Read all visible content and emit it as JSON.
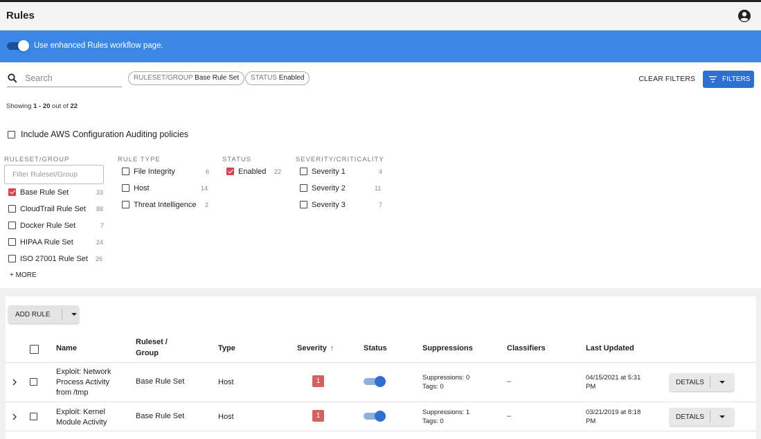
{
  "header": {
    "title": "Rules",
    "account_icon": "account-circle-icon"
  },
  "banner": {
    "toggle_on": true,
    "text": "Use enhanced Rules workflow page."
  },
  "search": {
    "placeholder": "Search",
    "value": ""
  },
  "chips": [
    {
      "key": "RULESET/GROUP",
      "value": "Base Rule Set"
    },
    {
      "key": "STATUS",
      "value": "Enabled"
    }
  ],
  "toolbar": {
    "clear_filters": "CLEAR FILTERS",
    "filters": "FILTERS"
  },
  "showing": {
    "prefix": "Showing ",
    "range": "1 - 20",
    "mid": " out of ",
    "total": "22"
  },
  "aws_option": {
    "label": "Include AWS Configuration Auditing policies",
    "checked": false
  },
  "facets": {
    "ruleset": {
      "heading": "RULESET/GROUP",
      "filter_placeholder": "Filter Ruleset/Group",
      "options": [
        {
          "label": "Base Rule Set",
          "count": "33",
          "checked": true
        },
        {
          "label": "CloudTrail Rule Set",
          "count": "88",
          "checked": false
        },
        {
          "label": "Docker Rule Set",
          "count": "7",
          "checked": false
        },
        {
          "label": "HIPAA Rule Set",
          "count": "24",
          "checked": false
        },
        {
          "label": "ISO 27001 Rule Set",
          "count": "26",
          "checked": false
        }
      ],
      "more": "+ MORE"
    },
    "rule_type": {
      "heading": "RULE TYPE",
      "options": [
        {
          "label": "File Integrity",
          "count": "6",
          "checked": false
        },
        {
          "label": "Host",
          "count": "14",
          "checked": false
        },
        {
          "label": "Threat Intelligence",
          "count": "2",
          "checked": false
        }
      ]
    },
    "status": {
      "heading": "STATUS",
      "options": [
        {
          "label": "Enabled",
          "count": "22",
          "checked": true
        }
      ]
    },
    "severity": {
      "heading": "SEVERITY/CRITICALITY",
      "options": [
        {
          "label": "Severity 1",
          "count": "4",
          "checked": false
        },
        {
          "label": "Severity 2",
          "count": "11",
          "checked": false
        },
        {
          "label": "Severity 3",
          "count": "7",
          "checked": false
        }
      ]
    }
  },
  "add_rule": {
    "label": "ADD RULE"
  },
  "table": {
    "columns": {
      "name": "Name",
      "ruleset_line1": "Ruleset /",
      "ruleset_line2": "Group",
      "type": "Type",
      "severity": "Severity",
      "status": "Status",
      "suppressions": "Suppressions",
      "classifiers": "Classifiers",
      "last_updated": "Last Updated"
    },
    "sort": {
      "column": "Severity",
      "direction": "ascending"
    },
    "rows": [
      {
        "name_lines": [
          "Exploit: Network",
          "Process Activity",
          "from /tmp"
        ],
        "ruleset": "Base Rule Set",
        "type": "Host",
        "severity": "1",
        "status_enabled": true,
        "suppressions": "Suppressions: 0",
        "tags": "Tags: 0",
        "classifiers": "–",
        "updated_line1": "04/15/2021 at 5:31",
        "updated_line2": "PM",
        "details": "DETAILS"
      },
      {
        "name_lines": [
          "Exploit: Kernel",
          "Module Activity"
        ],
        "ruleset": "Base Rule Set",
        "type": "Host",
        "severity": "1",
        "status_enabled": true,
        "suppressions": "Suppressions: 1",
        "tags": "Tags: 0",
        "classifiers": "–",
        "updated_line1": "03/21/2019 at 8:18",
        "updated_line2": "PM",
        "details": "DETAILS"
      }
    ]
  },
  "colors": {
    "banner": "#3b87e6",
    "primary": "#2f6fd1",
    "severity_badge": "#d66060",
    "checkbox_checked": "#d9424e"
  }
}
